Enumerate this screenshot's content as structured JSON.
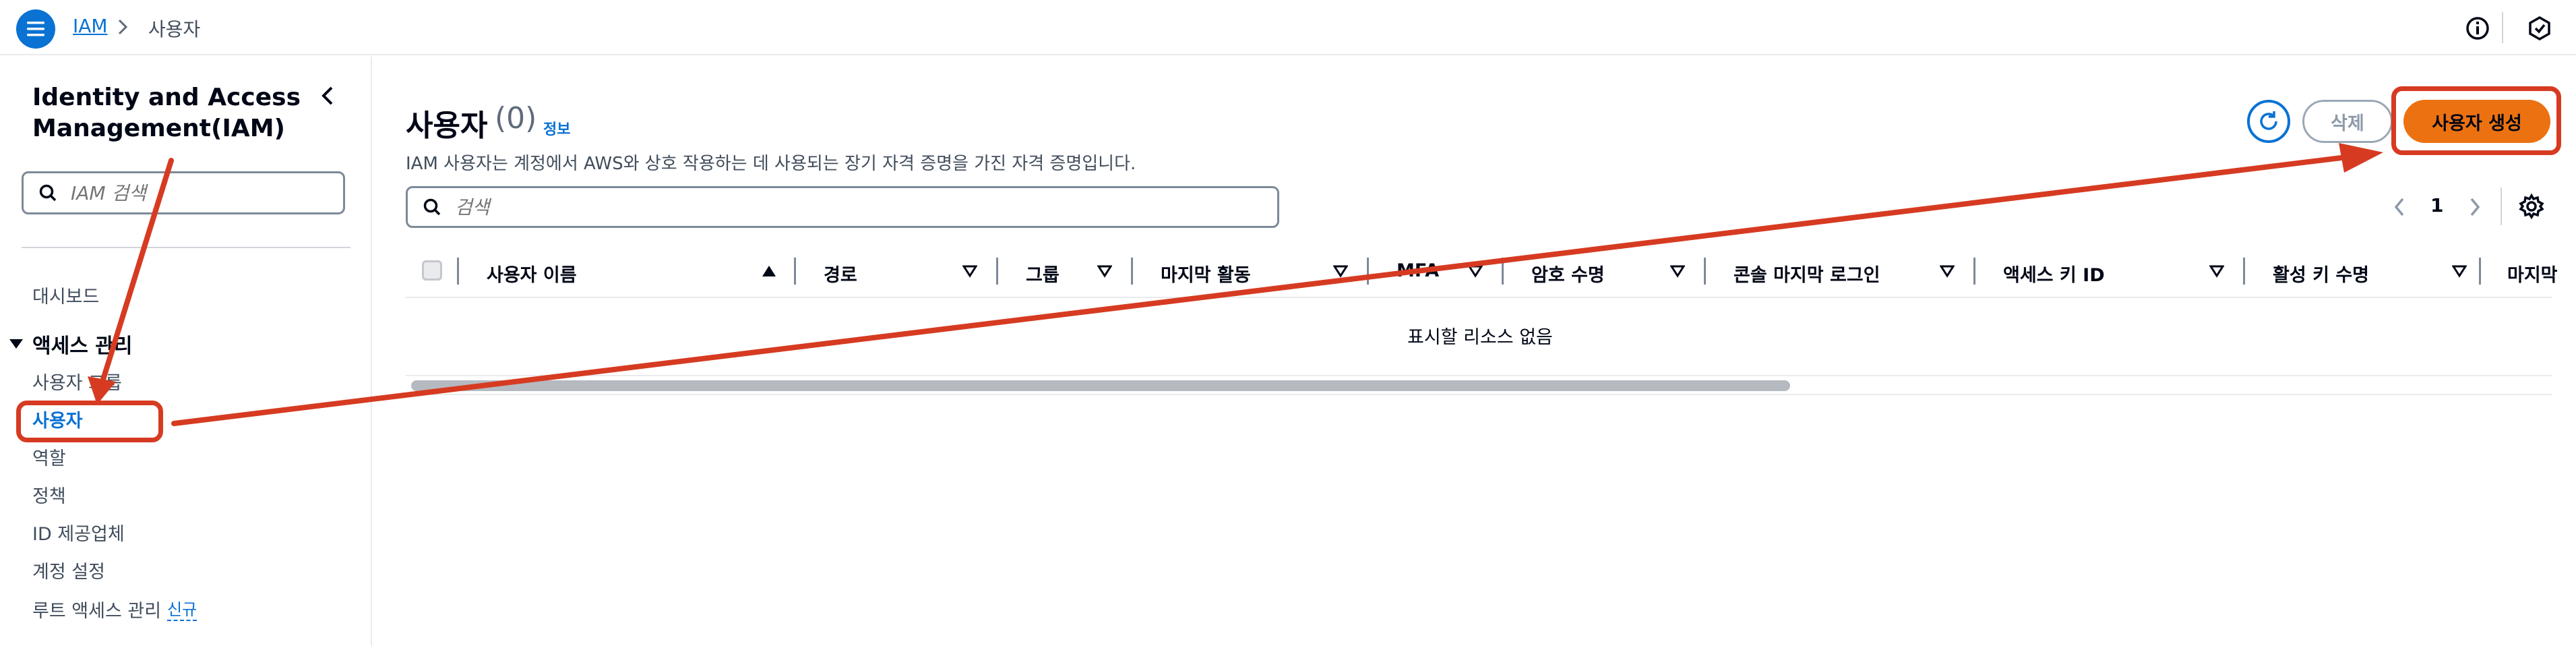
{
  "topbar": {
    "breadcrumb": [
      "IAM",
      "사용자"
    ]
  },
  "sidebar": {
    "title": "Identity and Access Management(IAM)",
    "search_placeholder": "IAM 검색",
    "dashboard": "대시보드",
    "section": "액세스 관리",
    "items": [
      "사용자 그룹",
      "사용자",
      "역할",
      "정책",
      "ID 제공업체",
      "계정 설정",
      "루트 액세스 관리"
    ],
    "new_badge": "신규"
  },
  "main": {
    "title": "사용자",
    "count": "(0)",
    "info": "정보",
    "description": "IAM 사용자는 계정에서 AWS와 상호 작용하는 데 사용되는 장기 자격 증명을 가진 자격 증명입니다.",
    "delete_label": "삭제",
    "create_label": "사용자 생성",
    "search_placeholder": "검색",
    "page_number": "1",
    "columns": [
      "사용자 이름",
      "경로",
      "그룹",
      "마지막 활동",
      "MFA",
      "암호 수명",
      "콘솔 마지막 로그인",
      "액세스 키 ID",
      "활성 키 수명",
      "마지막"
    ],
    "empty_message": "표시할 리소스 없음"
  },
  "colors": {
    "primary": "#0972d3",
    "accent": "#ec7211",
    "annotation": "#d63b22"
  }
}
